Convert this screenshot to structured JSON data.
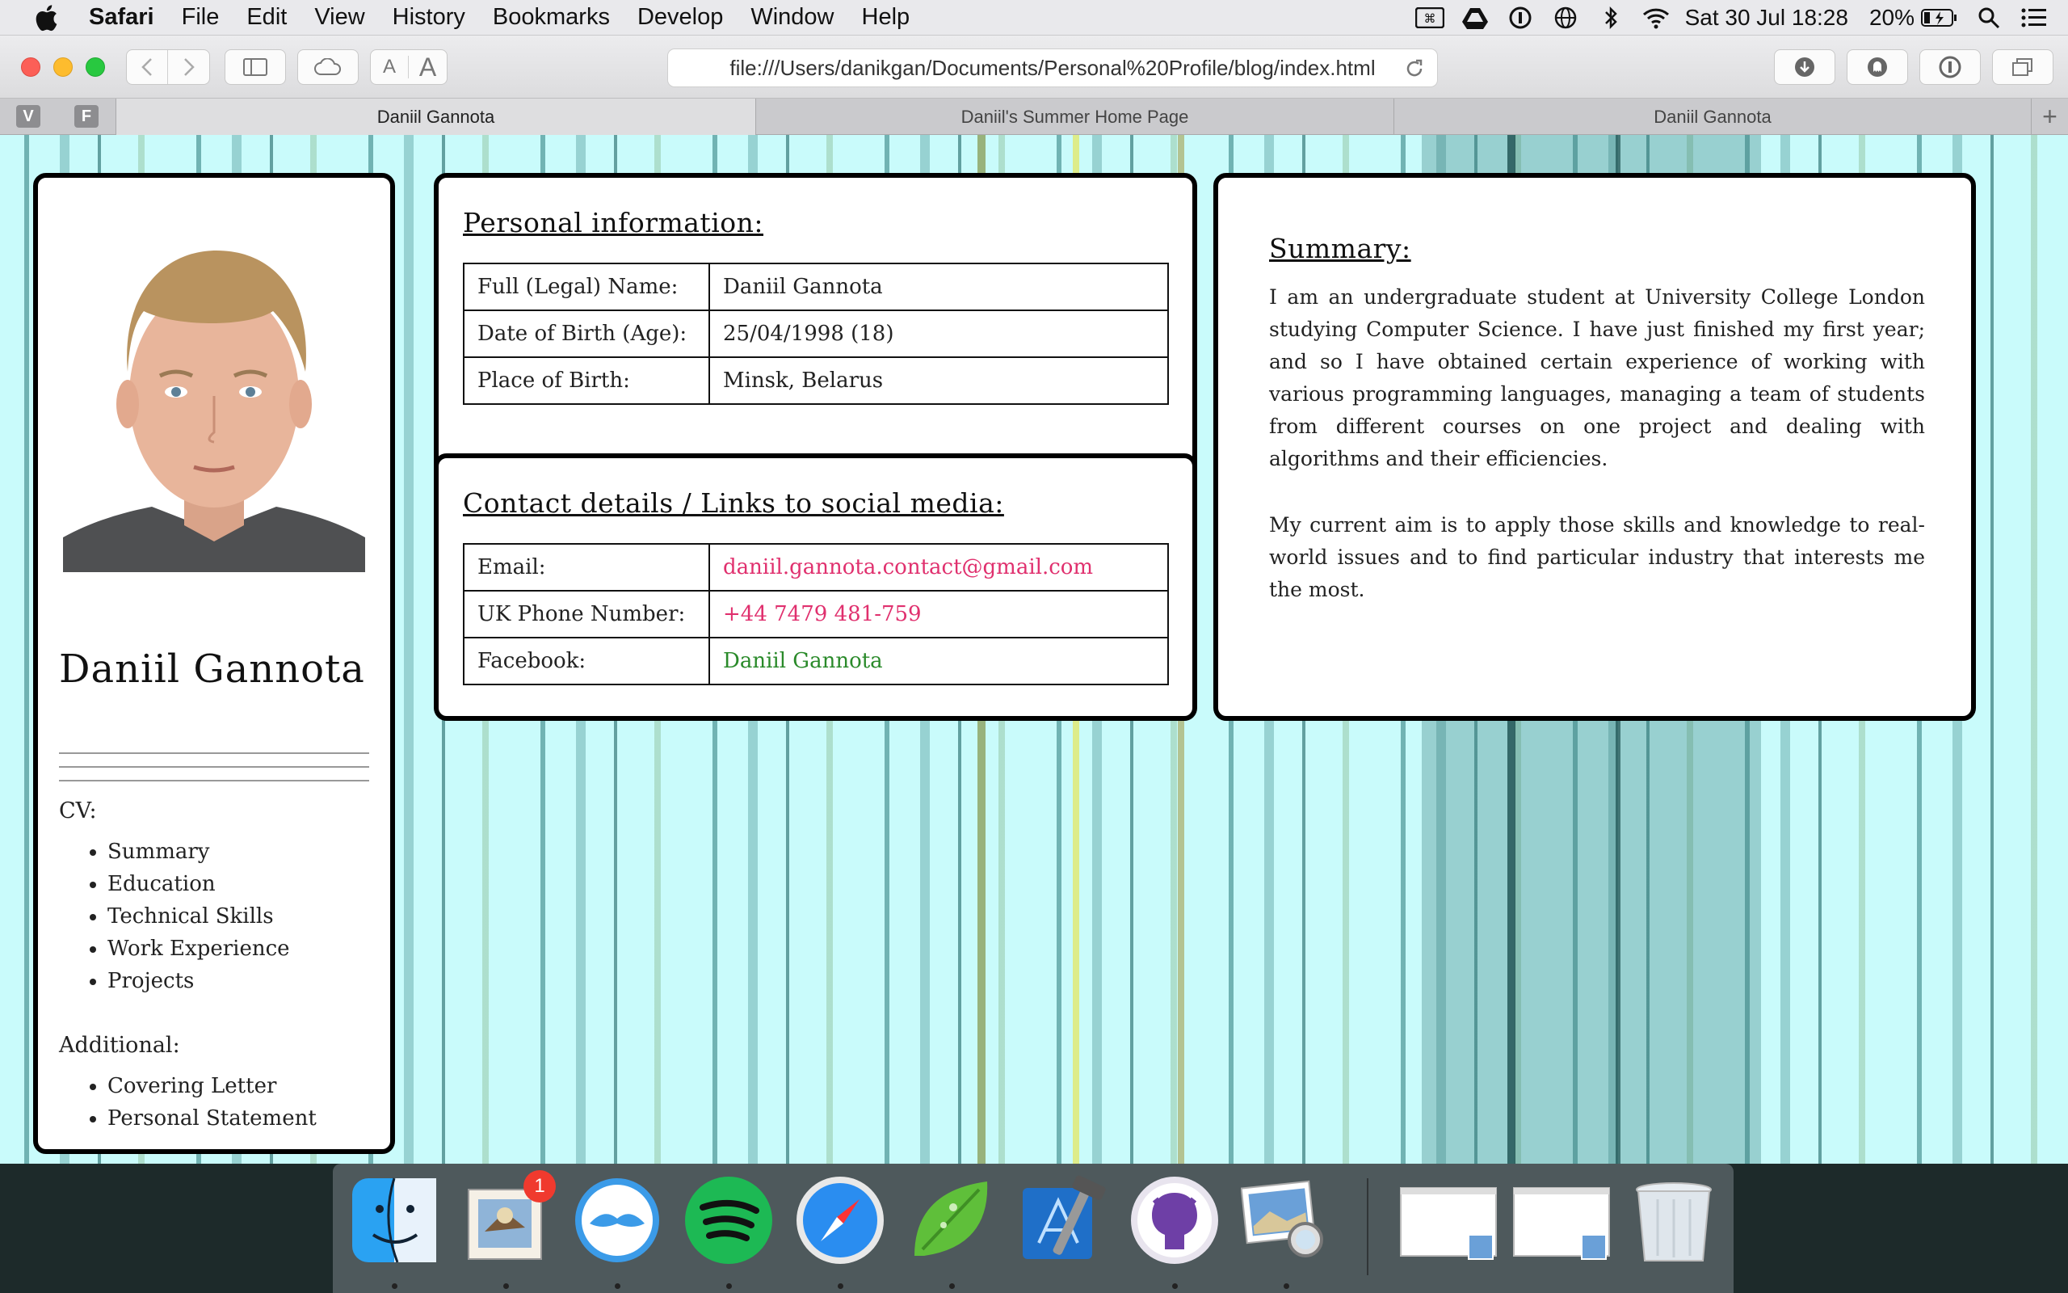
{
  "menubar": {
    "app": "Safari",
    "items": [
      "File",
      "Edit",
      "View",
      "History",
      "Bookmarks",
      "Develop",
      "Window",
      "Help"
    ],
    "clock": "Sat 30 Jul  18:28",
    "battery": "20%"
  },
  "browser": {
    "url": "file:///Users/danikgan/Documents/Personal%20Profile/blog/index.html",
    "pinned_tabs": [
      "V",
      "F"
    ],
    "tabs": [
      {
        "label": "Daniil Gannota",
        "active": true
      },
      {
        "label": "Daniil's Summer Home Page",
        "active": false
      },
      {
        "label": "Daniil Gannota",
        "active": false
      }
    ]
  },
  "profile": {
    "name": "Daniil Gannota",
    "cv_heading": "CV:",
    "cv_items": [
      "Summary",
      "Education",
      "Technical Skills",
      "Work Experience",
      "Projects"
    ],
    "additional_heading": "Additional:",
    "additional_items": [
      "Covering Letter",
      "Personal Statement"
    ]
  },
  "personal_info": {
    "title": "Personal information:",
    "rows": [
      {
        "label": "Full (Legal) Name:",
        "value": "Daniil Gannota"
      },
      {
        "label": "Date of Birth (Age):",
        "value": "25/04/1998 (18)"
      },
      {
        "label": "Place of Birth:",
        "value": "Minsk, Belarus"
      }
    ]
  },
  "contacts": {
    "title": "Contact details / Links to social media:",
    "rows": [
      {
        "label": "Email:",
        "value": "daniil.gannota.contact@gmail.com"
      },
      {
        "label": "UK Phone Number:",
        "value": "+44 7479 481-759"
      },
      {
        "label": "Facebook:",
        "value": "Daniil Gannota"
      }
    ]
  },
  "summary": {
    "title": "Summary:",
    "paragraphs": [
      "I am an undergraduate student at University College London studying Computer Science. I have just finished my first year; and so I have obtained certain experience of working with various programming languages, managing a team of students from different courses on one project and dealing with algorithms and their efficiencies.",
      "My current aim is to apply those skills and knowledge to real-world issues and to find particular industry that interests me the most."
    ]
  },
  "dock": {
    "mail_badge": "1",
    "apps": [
      "finder-icon",
      "mail-icon",
      "tweetbot-icon",
      "spotify-icon",
      "safari-icon",
      "coda-icon",
      "xcode-icon",
      "github-desktop-icon",
      "preview-icon"
    ]
  },
  "colors": {
    "page_bg": "#c9fbfb",
    "link_pink": "#e0306e",
    "link_green": "#2a8a2a"
  }
}
